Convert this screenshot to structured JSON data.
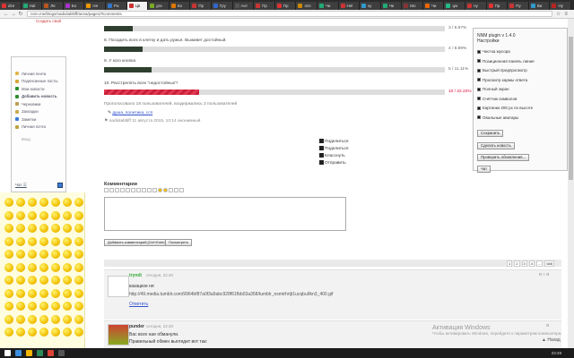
{
  "browser": {
    "tabs": [
      "dze",
      "Hal",
      "Ле",
      "Бо",
      "Ня",
      "Pa",
      "Цв",
      "gra",
      "Ка",
      "Пр",
      "Гру",
      "Ант",
      "Пр",
      "Пр",
      "4ze",
      "Чи",
      "Hel",
      "ку",
      "Чи",
      "Mo",
      "Чи",
      "qw",
      "ny",
      "Пр",
      "Пу",
      "Ви",
      "Ну"
    ],
    "url": "nnm.me/blogs/nadiolabltiff/anna/page1/#comments"
  },
  "top_cutoff_link": "Создать свой",
  "left_menu": {
    "items": [
      "Личная лента",
      "Подписанные посты",
      "Мои новости",
      "Добавить новость",
      "Черновики",
      "Закладки",
      "Заметки",
      "Личная почта",
      "Вход"
    ],
    "logout": "Чат ☰"
  },
  "poll": {
    "bars": [
      {
        "text": "",
        "pct": "3 / 6.67%",
        "fill": 6.67,
        "red": false
      },
      {
        "text": "8. Посадить всех в клетку и дать ружья. Выживет достойный.",
        "pct": "4 / 8.89%",
        "fill": 8.89,
        "red": false
      },
      {
        "text": "9. У кого кнопка",
        "pct": "5 / 11.11%",
        "fill": 11.11,
        "red": false
      },
      {
        "text": "10. Расстрелять всех \"недостойных\"!",
        "pct": "10 / 22.22%",
        "fill": 22.22,
        "red": true
      }
    ],
    "total": "Проголосовало 18 пользователей, воздержались 3 пользователей",
    "tags": "душа, политика, ссп",
    "author_line": "nadiolabltiff  11 августа 2015, 10:14  анонимный"
  },
  "share": {
    "items": [
      "Поделиться",
      "Поделиться",
      "Класснуть",
      "Отправить"
    ]
  },
  "comments": {
    "title": "Комментарии",
    "submit": "Добавить комментарий [Ctrl+Enter]",
    "preview": "Посмотреть",
    "pages": [
      "1",
      "2",
      "3",
      "4",
      "...",
      "688"
    ],
    "list": [
      {
        "author": "tryndi",
        "meta": "сегодня, 22:40",
        "text1": "казацкое ня",
        "text2": "http://49.media.tumblr.com/9964bf87a0f3a9abc928f61fbb03a358/tumblr_nsmtrhrtjt1ucqbu9kn3_400.gif",
        "reply": "Ответить",
        "votes": "0 ○ 0"
      },
      {
        "author": "punder",
        "meta": "сегодня, 22:40",
        "text1": "Вас всех нае обманули.",
        "text2": "Правильный обмен выглядит вот так:",
        "reply": "",
        "votes": "0"
      }
    ]
  },
  "settings": {
    "title": "NNM plugin v 1.4.0",
    "subtitle": "Настройки",
    "options": [
      "Чистка мусора",
      "Позиционная панель линия",
      "Быстрый предпросмотр",
      "Просмотр кармы ответа",
      "Полный экран",
      "Счётчик символов",
      "Картинки 200 px по высоте",
      "Овальные аватары"
    ],
    "save": "Сохранить",
    "reset": "Сделать новость",
    "check_updates": "Проверить обновления...",
    "chat": "Чат"
  },
  "activation": {
    "title": "Активация Windows",
    "sub": "Чтобы активировать Windows, перейдите к параметрам компьютера."
  },
  "back": "Назад",
  "clock": "23:49"
}
